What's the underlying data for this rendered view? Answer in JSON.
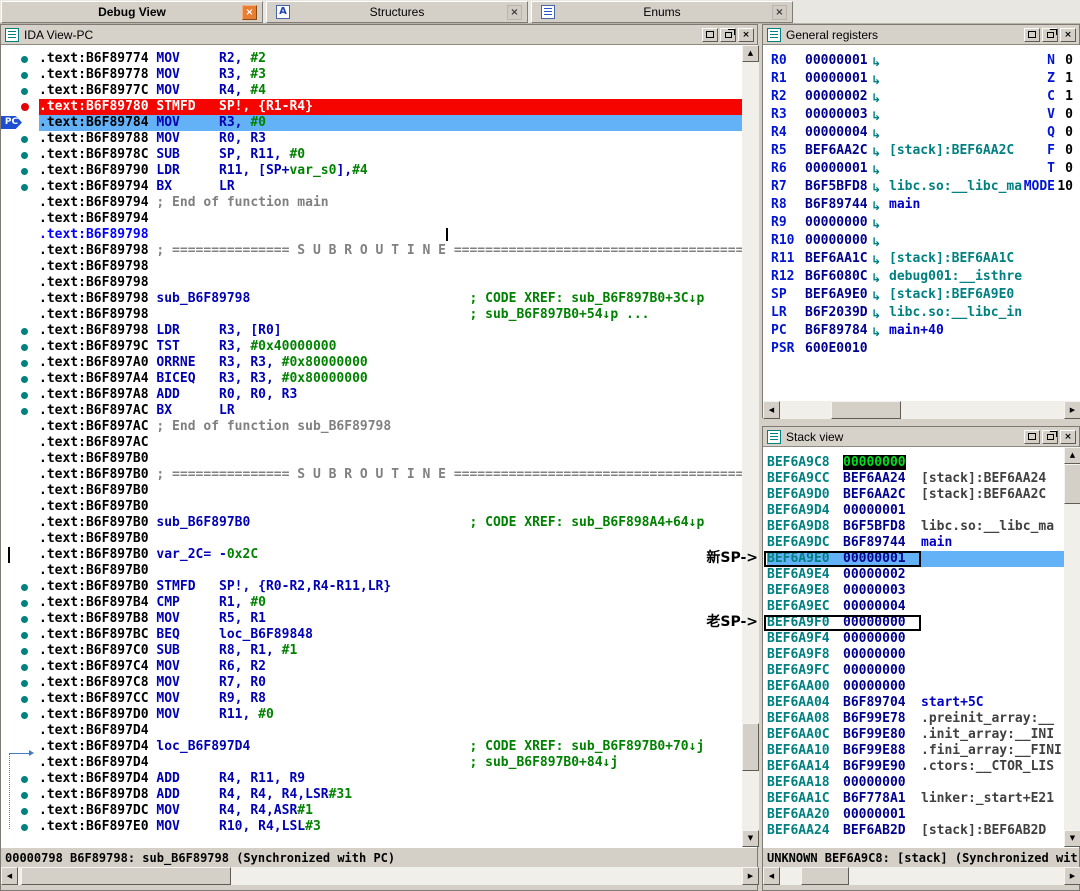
{
  "colors": {
    "chrome": "#d4d0c8",
    "bp_bg": "#f60400",
    "pc_bg": "#63b1f6",
    "code_blue": "#0000b4",
    "num_green": "#008200",
    "cmt_gray": "#808080",
    "teal": "#008080",
    "reg_blue": "#0014d2",
    "navy": "#000090",
    "sel_fg": "#00e020",
    "ann_gray": "#404040",
    "ann_blue": "#0000c8"
  },
  "chrome": {
    "close": "×",
    "arrow_up": "▲",
    "arrow_down": "▼",
    "arrow_left": "◀",
    "arrow_right": "▶"
  },
  "tabs": [
    {
      "id": "debug-view",
      "label": "Debug View",
      "active": true,
      "close_hot": true
    },
    {
      "id": "structures",
      "label": "Structures",
      "icon": "structures-icon",
      "icon_glyph": "A"
    },
    {
      "id": "enums",
      "label": "Enums",
      "icon": "enums-icon"
    }
  ],
  "annotations": {
    "new_sp": "新SP->",
    "old_sp": "老SP->"
  },
  "disasm": {
    "title": "IDA View-PC",
    "pc_badge": "PC",
    "status": "00000798 B6F89798: sub_B6F89798 (Synchronized with PC)",
    "lines": [
      {
        "a": ".text:B6F89774",
        "m": "dot",
        "t": [
          [
            "c",
            "MOV     R2, "
          ],
          [
            "n",
            "#2"
          ]
        ]
      },
      {
        "a": ".text:B6F89778",
        "m": "dot",
        "t": [
          [
            "c",
            "MOV     R3, "
          ],
          [
            "n",
            "#3"
          ]
        ]
      },
      {
        "a": ".text:B6F8977C",
        "m": "dot",
        "t": [
          [
            "c",
            "MOV     R4, "
          ],
          [
            "n",
            "#4"
          ]
        ]
      },
      {
        "a": ".text:B6F89780",
        "m": "bp",
        "bg": "bp",
        "t": [
          [
            "w",
            "STMFD   SP!, {R1-R4}"
          ]
        ]
      },
      {
        "a": ".text:B6F89784",
        "m": "pc",
        "bg": "pc",
        "t": [
          [
            "c",
            "MOV     R3, "
          ],
          [
            "n",
            "#0"
          ]
        ]
      },
      {
        "a": ".text:B6F89788",
        "m": "dot",
        "t": [
          [
            "c",
            "MOV     R0, R3"
          ]
        ]
      },
      {
        "a": ".text:B6F8978C",
        "m": "dot",
        "t": [
          [
            "c",
            "SUB     SP, R11, "
          ],
          [
            "n",
            "#0"
          ]
        ]
      },
      {
        "a": ".text:B6F89790",
        "m": "dot",
        "t": [
          [
            "c",
            "LDR     R11, [SP+"
          ],
          [
            "n",
            "var_s0"
          ],
          [
            "c",
            "],"
          ],
          [
            "n",
            "#4"
          ]
        ]
      },
      {
        "a": ".text:B6F89794",
        "m": "dot",
        "t": [
          [
            "c",
            "BX      LR"
          ]
        ]
      },
      {
        "a": ".text:B6F89794",
        "t": [
          [
            "g",
            "; End of function main"
          ]
        ]
      },
      {
        "a": ".text:B6F89794",
        "t": []
      },
      {
        "a": ".text:B6F89798",
        "ac": "blue",
        "t": [],
        "caret": 407
      },
      {
        "a": ".text:B6F89798",
        "t": [
          [
            "g",
            "; =============== S U B R O U T I N E ======================================="
          ]
        ]
      },
      {
        "a": ".text:B6F89798",
        "t": []
      },
      {
        "a": ".text:B6F89798",
        "t": []
      },
      {
        "a": ".text:B6F89798",
        "t": [
          [
            "c",
            "sub_B6F89798                            "
          ],
          [
            "x",
            "; CODE XREF: sub_B6F897B0+3C↓p"
          ]
        ]
      },
      {
        "a": ".text:B6F89798",
        "t": [
          [
            "c",
            "                                        "
          ],
          [
            "x",
            "; sub_B6F897B0+54↓p ..."
          ]
        ]
      },
      {
        "a": ".text:B6F89798",
        "m": "dot",
        "t": [
          [
            "c",
            "LDR     R3, [R0]"
          ]
        ]
      },
      {
        "a": ".text:B6F8979C",
        "m": "dot",
        "t": [
          [
            "c",
            "TST     R3, "
          ],
          [
            "n",
            "#0x40000000"
          ]
        ]
      },
      {
        "a": ".text:B6F897A0",
        "m": "dot",
        "t": [
          [
            "c",
            "ORRNE   R3, R3, "
          ],
          [
            "n",
            "#0x80000000"
          ]
        ]
      },
      {
        "a": ".text:B6F897A4",
        "m": "dot",
        "t": [
          [
            "c",
            "BICEQ   R3, R3, "
          ],
          [
            "n",
            "#0x80000000"
          ]
        ]
      },
      {
        "a": ".text:B6F897A8",
        "m": "dot",
        "t": [
          [
            "c",
            "ADD     R0, R0, R3"
          ]
        ]
      },
      {
        "a": ".text:B6F897AC",
        "m": "dot",
        "t": [
          [
            "c",
            "BX      LR"
          ]
        ]
      },
      {
        "a": ".text:B6F897AC",
        "t": [
          [
            "g",
            "; End of function sub_B6F89798"
          ]
        ]
      },
      {
        "a": ".text:B6F897AC",
        "t": []
      },
      {
        "a": ".text:B6F897B0",
        "t": []
      },
      {
        "a": ".text:B6F897B0",
        "t": [
          [
            "g",
            "; =============== S U B R O U T I N E ======================================="
          ]
        ]
      },
      {
        "a": ".text:B6F897B0",
        "t": []
      },
      {
        "a": ".text:B6F897B0",
        "t": []
      },
      {
        "a": ".text:B6F897B0",
        "t": [
          [
            "c",
            "sub_B6F897B0                            "
          ],
          [
            "x",
            "; CODE XREF: sub_B6F898A4+64↓p"
          ]
        ]
      },
      {
        "a": ".text:B6F897B0",
        "t": []
      },
      {
        "a": ".text:B6F897B0",
        "t": [
          [
            "c",
            "var_2C"
          ],
          [
            "c",
            "= -"
          ],
          [
            "n",
            "0x2C"
          ]
        ]
      },
      {
        "a": ".text:B6F897B0",
        "t": []
      },
      {
        "a": ".text:B6F897B0",
        "m": "dot",
        "t": [
          [
            "c",
            "STMFD   SP!, {R0-R2,R4-R11,LR}"
          ]
        ]
      },
      {
        "a": ".text:B6F897B4",
        "m": "dot",
        "t": [
          [
            "c",
            "CMP     R1, "
          ],
          [
            "n",
            "#0"
          ]
        ]
      },
      {
        "a": ".text:B6F897B8",
        "m": "dot",
        "t": [
          [
            "c",
            "MOV     R5, R1"
          ]
        ]
      },
      {
        "a": ".text:B6F897BC",
        "m": "dot",
        "t": [
          [
            "c",
            "BEQ     loc_B6F89848"
          ]
        ]
      },
      {
        "a": ".text:B6F897C0",
        "m": "dot",
        "t": [
          [
            "c",
            "SUB     R8, R1, "
          ],
          [
            "n",
            "#1"
          ]
        ]
      },
      {
        "a": ".text:B6F897C4",
        "m": "dot",
        "t": [
          [
            "c",
            "MOV     R6, R2"
          ]
        ]
      },
      {
        "a": ".text:B6F897C8",
        "m": "dot",
        "t": [
          [
            "c",
            "MOV     R7, R0"
          ]
        ]
      },
      {
        "a": ".text:B6F897CC",
        "m": "dot",
        "t": [
          [
            "c",
            "MOV     R9, R8"
          ]
        ]
      },
      {
        "a": ".text:B6F897D0",
        "m": "dot",
        "t": [
          [
            "c",
            "MOV     R11, "
          ],
          [
            "n",
            "#0"
          ]
        ]
      },
      {
        "a": ".text:B6F897D4",
        "t": []
      },
      {
        "a": ".text:B6F897D4",
        "t": [
          [
            "c",
            "loc_B6F897D4                            "
          ],
          [
            "x",
            "; CODE XREF: sub_B6F897B0+70↓j"
          ]
        ]
      },
      {
        "a": ".text:B6F897D4",
        "t": [
          [
            "c",
            "                                        "
          ],
          [
            "x",
            "; sub_B6F897B0+84↓j"
          ]
        ]
      },
      {
        "a": ".text:B6F897D4",
        "m": "dot",
        "t": [
          [
            "c",
            "ADD     R4, R11, R9"
          ]
        ]
      },
      {
        "a": ".text:B6F897D8",
        "m": "dot",
        "t": [
          [
            "c",
            "ADD     R4, R4, R4,LSR"
          ],
          [
            "n",
            "#31"
          ]
        ]
      },
      {
        "a": ".text:B6F897DC",
        "m": "dot",
        "t": [
          [
            "c",
            "MOV     R4, R4,ASR"
          ],
          [
            "n",
            "#1"
          ]
        ]
      },
      {
        "a": ".text:B6F897E0",
        "m": "dot",
        "t": [
          [
            "c",
            "MOV     R10, R4,LSL"
          ],
          [
            "n",
            "#3"
          ]
        ]
      }
    ]
  },
  "registers": {
    "title": "General registers",
    "arrow_glyph": "↳",
    "rows": [
      {
        "n": "R0",
        "v": "00000001",
        "arrow": true
      },
      {
        "n": "R1",
        "v": "00000001",
        "arrow": true
      },
      {
        "n": "R2",
        "v": "00000002",
        "arrow": true
      },
      {
        "n": "R3",
        "v": "00000003",
        "arrow": true
      },
      {
        "n": "R4",
        "v": "00000004",
        "arrow": true
      },
      {
        "n": "R5",
        "v": "BEF6AA2C",
        "arrow": true,
        "ann": "[stack]:BEF6AA2C",
        "annc": "seg"
      },
      {
        "n": "R6",
        "v": "00000001",
        "arrow": true
      },
      {
        "n": "R7",
        "v": "B6F5BFD8",
        "arrow": true,
        "ann": "libc.so:__libc_ma",
        "annc": "seg"
      },
      {
        "n": "R8",
        "v": "B6F89744",
        "arrow": true,
        "ann": "main",
        "annc": "name"
      },
      {
        "n": "R9",
        "v": "00000000",
        "arrow": true
      },
      {
        "n": "R10",
        "v": "00000000",
        "arrow": true
      },
      {
        "n": "R11",
        "v": "BEF6AA1C",
        "arrow": true,
        "ann": "[stack]:BEF6AA1C",
        "annc": "seg"
      },
      {
        "n": "R12",
        "v": "B6F6080C",
        "arrow": true,
        "ann": "debug001:__isthre",
        "annc": "seg"
      },
      {
        "n": "SP",
        "v": "BEF6A9E0",
        "arrow": true,
        "ann": "[stack]:BEF6A9E0",
        "annc": "seg"
      },
      {
        "n": "LR",
        "v": "B6F2039D",
        "arrow": true,
        "ann": "libc.so:__libc_in",
        "annc": "seg"
      },
      {
        "n": "PC",
        "v": "B6F89784",
        "arrow": true,
        "ann": "main+40",
        "annc": "name"
      },
      {
        "n": "PSR",
        "v": "600E0010"
      }
    ],
    "flags": [
      [
        "N",
        "0"
      ],
      [
        "Z",
        "1"
      ],
      [
        "C",
        "1"
      ],
      [
        "V",
        "0"
      ],
      [
        "Q",
        "0"
      ],
      [
        "F",
        "0"
      ],
      [
        "T",
        "0"
      ],
      [
        "MODE",
        "10"
      ]
    ]
  },
  "stack": {
    "title": "Stack view",
    "status": "UNKNOWN BEF6A9C8: [stack] (Synchronized wit",
    "rows": [
      {
        "a": "BEF6A9C8",
        "v": "00000000",
        "sel": true
      },
      {
        "a": "BEF6A9CC",
        "v": "BEF6AA24",
        "ann": "[stack]:BEF6AA24",
        "annc": "seg"
      },
      {
        "a": "BEF6A9D0",
        "v": "BEF6AA2C",
        "ann": "[stack]:BEF6AA2C",
        "annc": "seg"
      },
      {
        "a": "BEF6A9D4",
        "v": "00000001"
      },
      {
        "a": "BEF6A9D8",
        "v": "B6F5BFD8",
        "ann": "libc.so:__libc_ma",
        "annc": "seg"
      },
      {
        "a": "BEF6A9DC",
        "v": "B6F89744",
        "ann": "main",
        "annc": "name"
      },
      {
        "a": "BEF6A9E0",
        "v": "00000001",
        "hl": true,
        "box": true
      },
      {
        "a": "BEF6A9E4",
        "v": "00000002"
      },
      {
        "a": "BEF6A9E8",
        "v": "00000003"
      },
      {
        "a": "BEF6A9EC",
        "v": "00000004"
      },
      {
        "a": "BEF6A9F0",
        "v": "00000000",
        "box": true
      },
      {
        "a": "BEF6A9F4",
        "v": "00000000"
      },
      {
        "a": "BEF6A9F8",
        "v": "00000000"
      },
      {
        "a": "BEF6A9FC",
        "v": "00000000"
      },
      {
        "a": "BEF6AA00",
        "v": "00000000"
      },
      {
        "a": "BEF6AA04",
        "v": "B6F89704",
        "ann": "start+5C",
        "annc": "name"
      },
      {
        "a": "BEF6AA08",
        "v": "B6F99E78",
        "ann": ".preinit_array:__",
        "annc": "seg"
      },
      {
        "a": "BEF6AA0C",
        "v": "B6F99E80",
        "ann": ".init_array:__INI",
        "annc": "seg"
      },
      {
        "a": "BEF6AA10",
        "v": "B6F99E88",
        "ann": ".fini_array:__FINI",
        "annc": "seg"
      },
      {
        "a": "BEF6AA14",
        "v": "B6F99E90",
        "ann": ".ctors:__CTOR_LIS",
        "annc": "seg"
      },
      {
        "a": "BEF6AA18",
        "v": "00000000"
      },
      {
        "a": "BEF6AA1C",
        "v": "B6F778A1",
        "ann": "linker:_start+E21",
        "annc": "seg"
      },
      {
        "a": "BEF6AA20",
        "v": "00000001"
      },
      {
        "a": "BEF6AA24",
        "v": "BEF6AB2D",
        "ann": "[stack]:BEF6AB2D",
        "annc": "seg"
      }
    ]
  }
}
